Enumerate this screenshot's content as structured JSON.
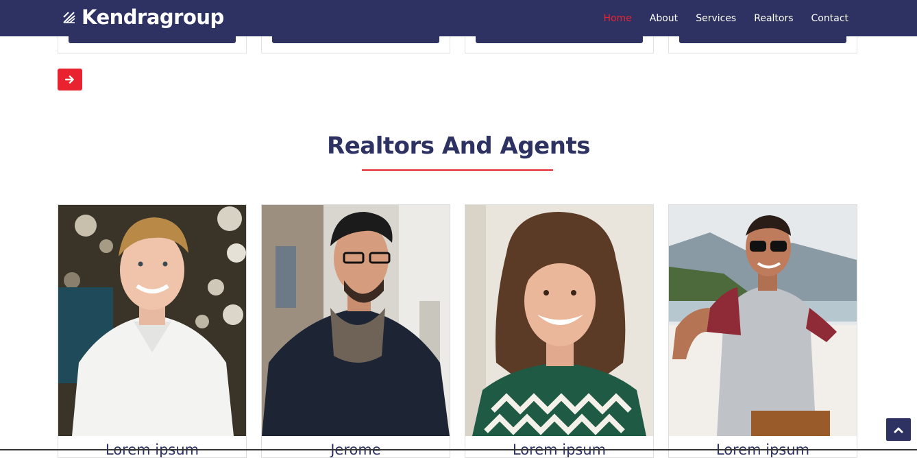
{
  "brand": {
    "name": "Kendragroup",
    "icon": "brand-slash-icon"
  },
  "nav": {
    "items": [
      {
        "label": "Home",
        "active": true
      },
      {
        "label": "About",
        "active": false
      },
      {
        "label": "Services",
        "active": false
      },
      {
        "label": "Realtors",
        "active": false
      },
      {
        "label": "Contact",
        "active": false
      }
    ]
  },
  "services_controls": {
    "next_icon": "arrow-right-icon"
  },
  "realtors": {
    "title": "Realtors And Agents",
    "agents": [
      {
        "name": "Lorem ipsum"
      },
      {
        "name": "Jerome"
      },
      {
        "name": "Lorem ipsum"
      },
      {
        "name": "Lorem ipsum"
      }
    ]
  },
  "scroll_top": {
    "icon": "chevron-up-icon"
  },
  "colors": {
    "primary": "#2d3262",
    "accent": "#e8232f",
    "background": "#ffffff"
  }
}
